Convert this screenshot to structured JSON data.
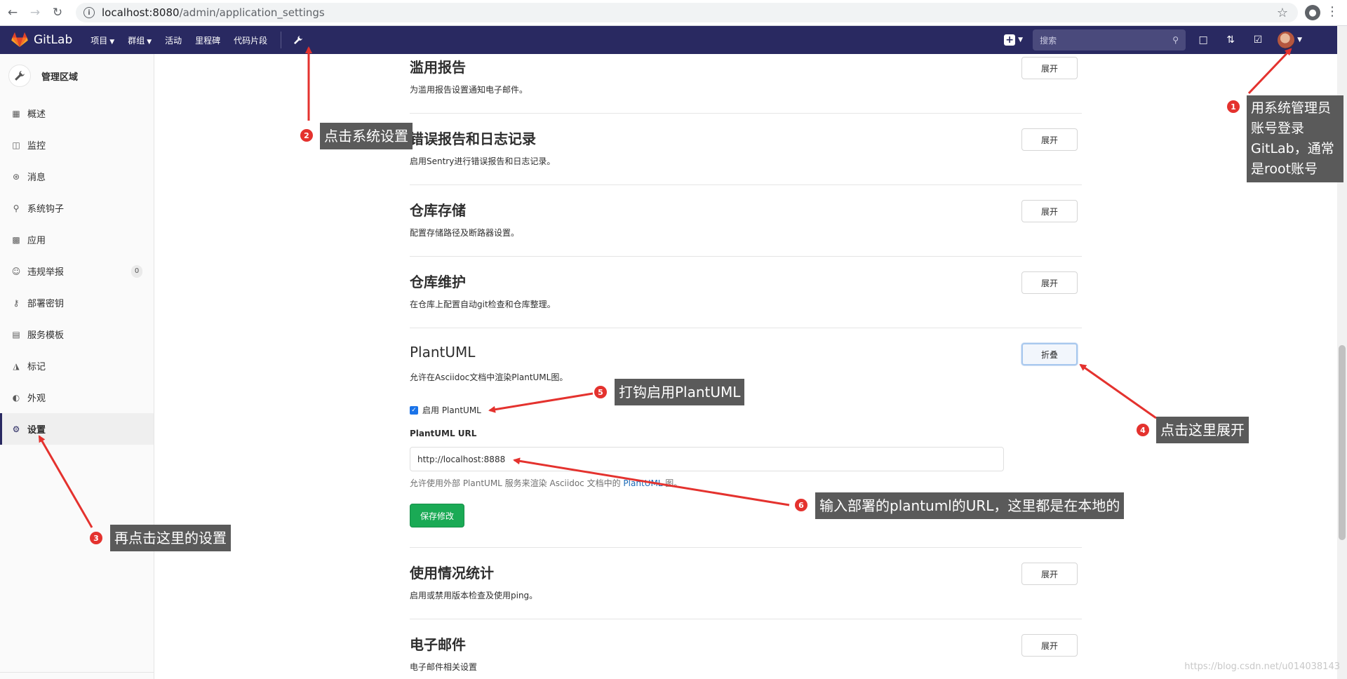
{
  "browser": {
    "url_host": "localhost:8080",
    "url_path": "/admin/application_settings"
  },
  "header": {
    "brand": "GitLab",
    "nav": [
      "项目",
      "群组",
      "活动",
      "里程碑",
      "代码片段"
    ],
    "search_placeholder": "搜索"
  },
  "sidebar": {
    "title": "管理区域",
    "items": [
      {
        "label": "概述",
        "icon": "grid-icon"
      },
      {
        "label": "监控",
        "icon": "monitor-icon"
      },
      {
        "label": "消息",
        "icon": "broadcast-icon"
      },
      {
        "label": "系统钩子",
        "icon": "hook-icon"
      },
      {
        "label": "应用",
        "icon": "apps-icon"
      },
      {
        "label": "违规举报",
        "icon": "abuse-icon",
        "badge": "0"
      },
      {
        "label": "部署密钥",
        "icon": "key-icon"
      },
      {
        "label": "服务模板",
        "icon": "template-icon"
      },
      {
        "label": "标记",
        "icon": "label-icon"
      },
      {
        "label": "外观",
        "icon": "palette-icon"
      },
      {
        "label": "设置",
        "icon": "gear-icon",
        "active": true
      }
    ]
  },
  "sections": {
    "abuse": {
      "title": "滥用报告",
      "desc": "为滥用报告设置通知电子邮件。",
      "button": "展开"
    },
    "errors": {
      "title": "错误报告和日志记录",
      "desc": "启用Sentry进行错误报告和日志记录。",
      "button": "展开"
    },
    "storage": {
      "title": "仓库存储",
      "desc": "配置存储路径及断路器设置。",
      "button": "展开"
    },
    "maintenance": {
      "title": "仓库维护",
      "desc": "在仓库上配置自动git检查和仓库整理。",
      "button": "展开"
    },
    "plantuml": {
      "title": "PlantUML",
      "desc": "允许在Asciidoc文档中渲染PlantUML图。",
      "button": "折叠",
      "checkbox_label": "启用 PlantUML",
      "url_label": "PlantUML URL",
      "url_value": "http://localhost:8888",
      "help_prefix": "允许使用外部 PlantUML 服务来渲染 Asciidoc 文档中的 ",
      "help_link": "PlantUML",
      "help_suffix": " 图。",
      "save": "保存修改"
    },
    "usage": {
      "title": "使用情况统计",
      "desc": "启用或禁用版本检查及使用ping。",
      "button": "展开"
    },
    "email": {
      "title": "电子邮件",
      "desc": "电子邮件相关设置",
      "button": "展开"
    }
  },
  "annotations": {
    "a1": {
      "num": "1",
      "lines": [
        "用系统管理员",
        "账号登录",
        "GitLab，通常",
        "是root账号"
      ]
    },
    "a2": {
      "num": "2",
      "text": "点击系统设置"
    },
    "a3": {
      "num": "3",
      "text": "再点击这里的设置"
    },
    "a4": {
      "num": "4",
      "text": "点击这里展开"
    },
    "a5": {
      "num": "5",
      "text": "打钩启用PlantUML"
    },
    "a6": {
      "num": "6",
      "text": "输入部署的plantuml的URL，这里都是在本地的"
    }
  },
  "watermark": "https://blog.csdn.net/u014038143"
}
